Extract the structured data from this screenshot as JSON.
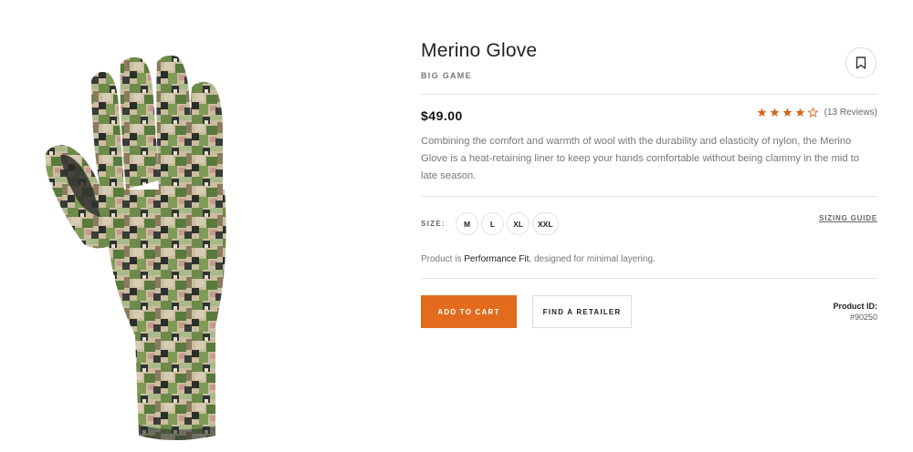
{
  "product": {
    "title": "Merino Glove",
    "category": "BIG GAME",
    "price": "$49.00",
    "rating": {
      "value": 4,
      "max": 5,
      "reviews_text": "(13 Reviews)"
    },
    "description": "Combining the comfort and warmth of wool with the durability and elasticity of nylon, the Merino Glove is a heat-retaining liner to keep your hands comfortable without being clammy in the mid to late season.",
    "size": {
      "label": "SIZE:",
      "options": [
        "M",
        "L",
        "XL",
        "XXL"
      ],
      "guide_label": "SIZING GUIDE"
    },
    "fit": {
      "prefix": "Product is ",
      "name": "Performance Fit",
      "suffix": ", designed for minimal layering."
    },
    "actions": {
      "add_to_cart": "ADD TO CART",
      "find_retailer": "FIND A RETAILER"
    },
    "product_id": {
      "label": "Product ID:",
      "value": "#90250"
    }
  },
  "icons": {
    "bookmark": "bookmark-icon",
    "star": "star-icon",
    "glove": "camo-glove-image"
  },
  "colors": {
    "accent": "#e26b1e",
    "star": "#d9661d"
  }
}
